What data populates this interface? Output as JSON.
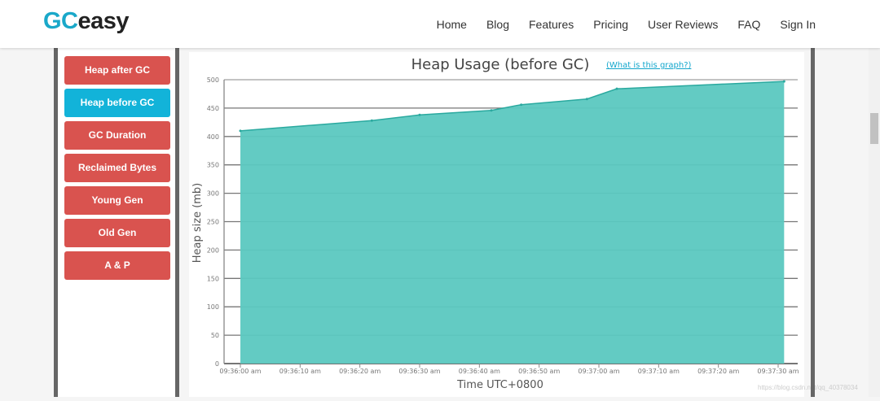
{
  "nav": {
    "logo": {
      "part1": "GC",
      "part2": "easy"
    },
    "items": [
      "Home",
      "Blog",
      "Features",
      "Pricing",
      "User Reviews",
      "FAQ",
      "Sign In"
    ]
  },
  "sidebar": {
    "buttons": [
      "Heap after GC",
      "Heap before GC",
      "GC Duration",
      "Reclaimed Bytes",
      "Young Gen",
      "Old Gen",
      "A & P"
    ],
    "active": "Heap before GC"
  },
  "chart_link": "(What is this graph?)",
  "watermark": "https://blog.csdn.net/qq_40378034",
  "chart_data": {
    "type": "area",
    "title": "Heap Usage (before GC)",
    "xlabel": "Time UTC+0800",
    "ylabel": "Heap size (mb)",
    "ylim": [
      0,
      500
    ],
    "yticks": [
      0,
      50,
      100,
      150,
      200,
      250,
      300,
      350,
      400,
      450,
      500
    ],
    "xticks": [
      "09:36:00 am",
      "09:36:10 am",
      "09:36:20 am",
      "09:36:30 am",
      "09:36:40 am",
      "09:36:50 am",
      "09:37:00 am",
      "09:37:10 am",
      "09:37:20 am",
      "09:37:30 am"
    ],
    "x": [
      "09:36:00",
      "09:36:22",
      "09:36:30",
      "09:36:42",
      "09:36:47",
      "09:36:58",
      "09:37:03",
      "09:37:31"
    ],
    "values": [
      410,
      428,
      438,
      446,
      456,
      466,
      484,
      497
    ],
    "color": "#5bc8c0",
    "grid": true
  }
}
